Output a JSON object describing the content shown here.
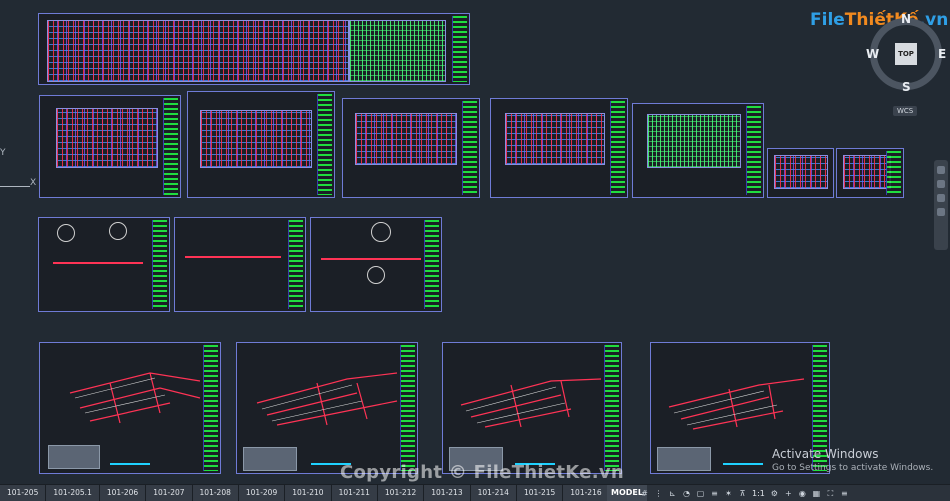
{
  "brand": {
    "logo_part1": "File",
    "logo_part2": "ThiếtKế",
    "logo_part3": ".vn"
  },
  "watermark": "Copyright © FileThietKe.vn",
  "activation": {
    "title": "Activate Windows",
    "subtitle": "Go to Settings to activate Windows."
  },
  "viewcube": {
    "top_label": "TOP",
    "north": "N",
    "south": "S",
    "west": "W",
    "east": "E",
    "wcs_label": "WCS"
  },
  "ucs": {
    "y": "Y",
    "x": "X"
  },
  "status": {
    "model_label": "MODEL",
    "scale": "1:1",
    "layout_tabs": [
      "101-205",
      "101-205.1",
      "101-206",
      "101-207",
      "101-208",
      "101-209",
      "101-210",
      "101-211",
      "101-212",
      "101-213",
      "101-214",
      "101-215",
      "101-216"
    ],
    "add_tab": "+"
  },
  "colors": {
    "background": "#222a33",
    "sheet_border": "#6f7bd6",
    "titleblock_green": "#22ff44",
    "pipe_red": "#ff3355",
    "brand_blue": "#2f9fe6",
    "brand_orange": "#f28a1f"
  }
}
